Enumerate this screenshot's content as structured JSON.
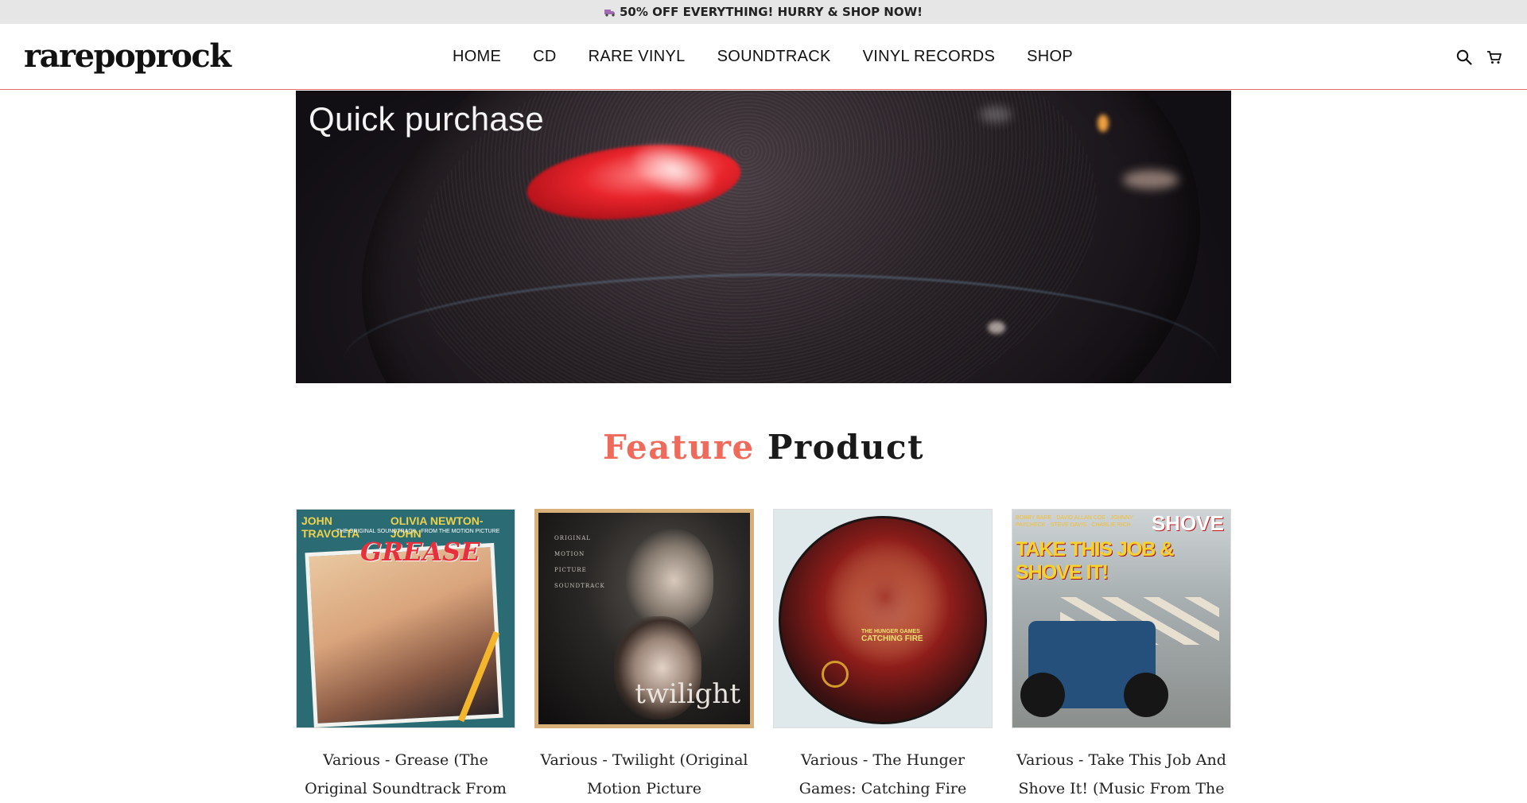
{
  "announcement": {
    "text": "50% OFF EVERYTHING! HURRY & SHOP NOW!",
    "icon": "truck-icon"
  },
  "header": {
    "logo": "rarepoprock",
    "nav": [
      "HOME",
      "CD",
      "RARE VINYL",
      "SOUNDTRACK",
      "VINYL RECORDS",
      "SHOP"
    ],
    "icons": [
      "search-icon",
      "cart-icon"
    ]
  },
  "hero": {
    "title": "Quick purchase"
  },
  "feature": {
    "accent": "Feature",
    "rest": "Product",
    "accent_color": "#ef6a5a"
  },
  "products": [
    {
      "title": "Various - Grease (The Original Soundtrack From The Motion Picture)",
      "cover": {
        "top_left": "JOHN TRAVOLTA",
        "top_right": "OLIVIA NEWTON-JOHN",
        "subtitle": "THE ORIGINAL SOUNDTRACK · FROM THE MOTION PICTURE",
        "logo": "GREASE"
      }
    },
    {
      "title": "Various - Twilight (Original Motion Picture Soundtrack)",
      "cover": {
        "lines": [
          "ORIGINAL",
          "MOTION",
          "PICTURE",
          "SOUNDTRACK"
        ],
        "logo": "twilight"
      }
    },
    {
      "title": "Various - The Hunger Games: Catching Fire (Original Motion Picture Soundtrack)",
      "cover": {
        "line1": "THE HUNGER GAMES",
        "line2": "CATCHING FIRE"
      }
    },
    {
      "title": "Various - Take This Job And Shove It! (Music From The Motion Picture)",
      "cover": {
        "names": "BOBBY BARE · DAVID ALLAN COE · JOHNNY PAYCHECK · STEVE DAVIS · CHARLIE RICH",
        "headline": "TAKE THIS JOB & SHOVE IT!",
        "shove": "SHOVE"
      }
    }
  ]
}
